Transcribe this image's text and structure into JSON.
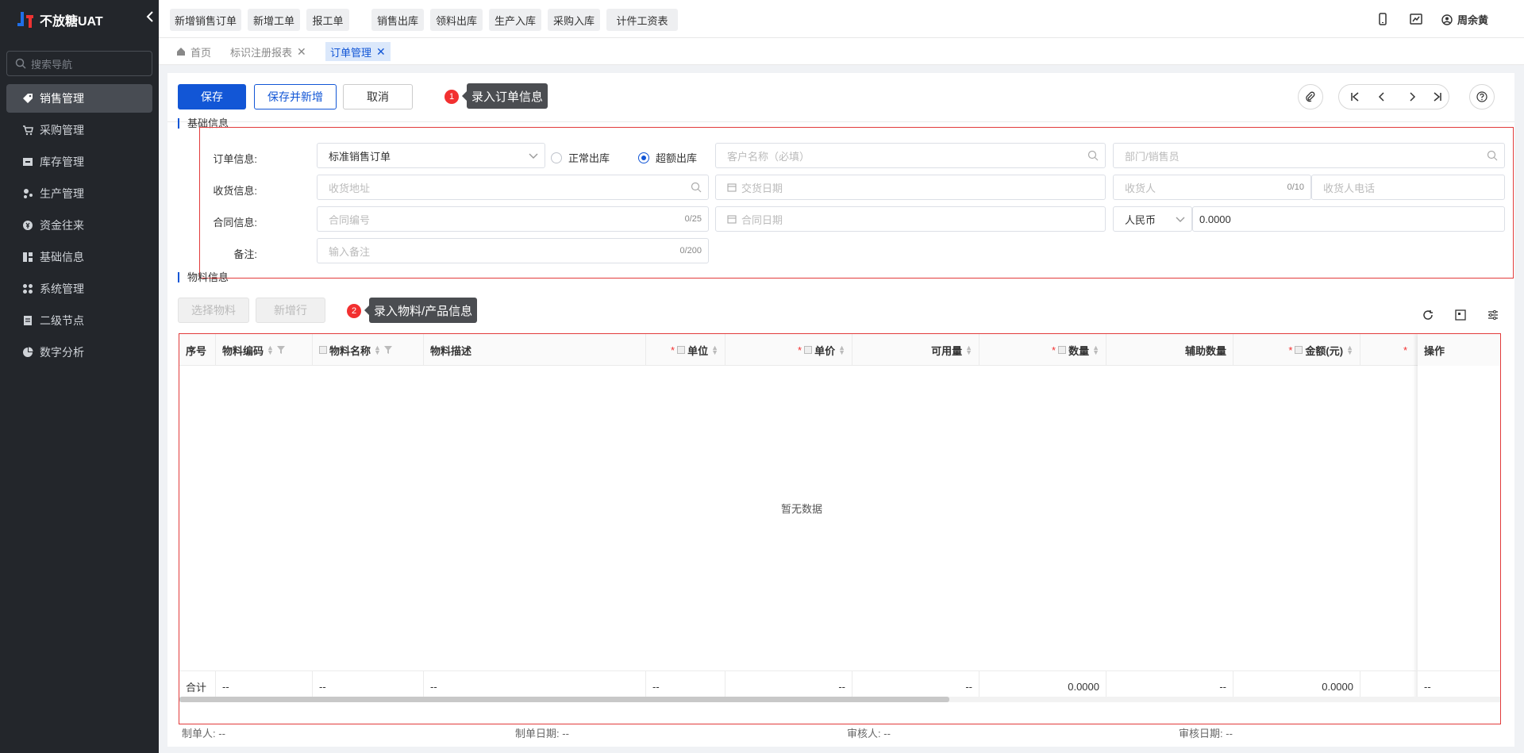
{
  "app": {
    "title": "不放糖UAT"
  },
  "sidebar": {
    "search_placeholder": "搜索导航",
    "items": [
      {
        "label": "销售管理",
        "icon": "tag-icon"
      },
      {
        "label": "采购管理",
        "icon": "cart-icon"
      },
      {
        "label": "库存管理",
        "icon": "warehouse-icon"
      },
      {
        "label": "生产管理",
        "icon": "production-icon"
      },
      {
        "label": "资金往来",
        "icon": "money-icon"
      },
      {
        "label": "基础信息",
        "icon": "grid-icon"
      },
      {
        "label": "系统管理",
        "icon": "settings-icon"
      },
      {
        "label": "二级节点",
        "icon": "document-icon"
      },
      {
        "label": "数字分析",
        "icon": "pie-chart-icon"
      }
    ]
  },
  "quick_actions": [
    "新增销售订单",
    "新增工单",
    "报工单",
    "销售出库",
    "领料出库",
    "生产入库",
    "采购入库",
    "计件工资表"
  ],
  "user": {
    "name": "周余黄"
  },
  "tabs": [
    {
      "label": "首页"
    },
    {
      "label": "标识注册报表"
    },
    {
      "label": "订单管理"
    }
  ],
  "toolbar": {
    "save": "保存",
    "save_new": "保存并新增",
    "cancel": "取消"
  },
  "tips": [
    {
      "num": "1",
      "text": "录入订单信息"
    },
    {
      "num": "2",
      "text": "录入物料/产品信息"
    }
  ],
  "basic": {
    "title": "基础信息",
    "order_label": "订单信息:",
    "order_type": "标准销售订单",
    "radio_normal": "正常出库",
    "radio_over": "超额出库",
    "customer_placeholder": "客户名称（必填）",
    "dept_placeholder": "部门/销售员",
    "ship_label": "收货信息:",
    "address_placeholder": "收货地址",
    "delivery_date_placeholder": "交货日期",
    "receiver_placeholder": "收货人",
    "receiver_count": "0/10",
    "receiver_phone_placeholder": "收货人电话",
    "contract_label": "合同信息:",
    "contract_no_placeholder": "合同编号",
    "contract_no_count": "0/25",
    "contract_date_placeholder": "合同日期",
    "currency": "人民币",
    "amount": "0.0000",
    "remark_label": "备注:",
    "remark_placeholder": "输入备注",
    "remark_count": "0/200"
  },
  "material": {
    "title": "物料信息",
    "select_btn": "选择物料",
    "add_row_btn": "新增行",
    "columns": [
      "序号",
      "物料编码",
      "物料名称",
      "物料描述",
      "单位",
      "单价",
      "可用量",
      "数量",
      "辅助数量",
      "金额(元)",
      "操作"
    ],
    "empty_text": "暂无数据",
    "total_label": "合计",
    "totals": [
      "--",
      "--",
      "--",
      "--",
      "--",
      "--",
      "0.0000",
      "--",
      "0.0000",
      "--"
    ]
  },
  "footer": {
    "creator_label": "制单人:",
    "creator": "--",
    "create_date_label": "制单日期:",
    "create_date": "--",
    "reviewer_label": "审核人:",
    "reviewer": "--",
    "review_date_label": "审核日期:",
    "review_date": "--"
  }
}
